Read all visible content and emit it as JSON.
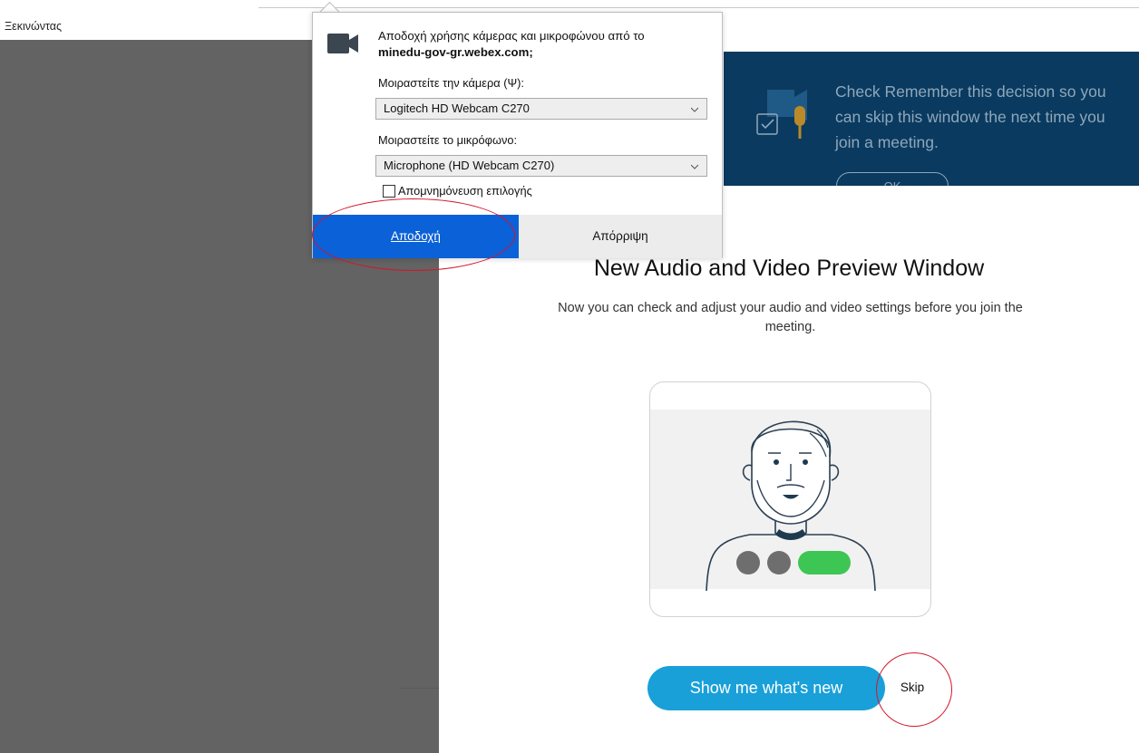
{
  "browser": {
    "tab_title": "Ξεκινώντας"
  },
  "permission_dialog": {
    "message_prefix": "Αποδοχή χρήσης κάμερας και μικροφώνου από το",
    "domain": "minedu-gov-gr.webex.com;",
    "camera_label": "Μοιραστείτε την κάμερα (Ψ):",
    "camera_value": "Logitech HD Webcam C270",
    "mic_label": "Μοιραστείτε το μικρόφωνο:",
    "mic_value": "Microphone (HD Webcam C270)",
    "remember_label": "Απομνημόνευση επιλογής",
    "remember_checked": false,
    "accept_label": "Αποδοχή",
    "reject_label": "Απόρριψη",
    "icon": "video-camera-icon"
  },
  "coach_tip": {
    "text": "Check Remember this decision so you can skip this window the next time you join a meeting.",
    "ok_label": "OK"
  },
  "preview": {
    "title": "New Audio and Video Preview Window",
    "subtitle": "Now you can check and adjust your audio and video settings before you join the meeting.",
    "primary_button": "Show me what's new",
    "skip_button": "Skip"
  },
  "colors": {
    "accept_blue": "#0b61d8",
    "primary_cyan": "#19a0d9",
    "tip_navy": "#0a3a5f",
    "annotation_red": "#d3162a",
    "left_pane_gray": "#636363"
  }
}
